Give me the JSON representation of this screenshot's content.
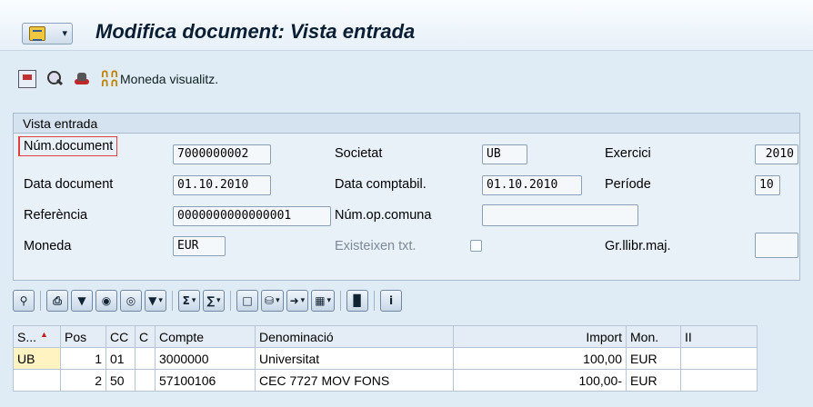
{
  "header": {
    "title": "Modifica document: Vista entrada"
  },
  "toolbar": {
    "currency_label": "Moneda visualitz."
  },
  "section": {
    "title": "Vista entrada"
  },
  "fields": {
    "num_document": {
      "label": "Núm.document",
      "value": "7000000002"
    },
    "societat": {
      "label": "Societat",
      "value": "UB"
    },
    "exercici": {
      "label": "Exercici",
      "value": "2010"
    },
    "data_document": {
      "label": "Data document",
      "value": "01.10.2010"
    },
    "data_comptabil": {
      "label": "Data comptabil.",
      "value": "01.10.2010"
    },
    "periode": {
      "label": "Període",
      "value": "10"
    },
    "referencia": {
      "label": "Referència",
      "value": "0000000000000001"
    },
    "num_op_comuna": {
      "label": "Núm.op.comuna",
      "value": ""
    },
    "moneda": {
      "label": "Moneda",
      "value": "EUR"
    },
    "existeixen_txt": {
      "label": "Existeixen txt."
    },
    "gr_llibr_maj": {
      "label": "Gr.llibr.maj.",
      "value": ""
    }
  },
  "alv": {
    "sigma": "Σ",
    "info": "i"
  },
  "table": {
    "columns": [
      "S...",
      "Pos",
      "CC",
      "C",
      "Compte",
      "Denominació",
      "Import",
      "Mon.",
      "II"
    ],
    "rows": [
      {
        "s": "UB",
        "pos": "1",
        "cc": "01",
        "c": "",
        "compte": "3000000",
        "denominacio": "Universitat",
        "import": "100,00",
        "mon": "EUR",
        "ii": ""
      },
      {
        "s": "",
        "pos": "2",
        "cc": "50",
        "c": "",
        "compte": "57100106",
        "denominacio": "CEC 7727 MOV FONS",
        "import": "100,00-",
        "mon": "EUR",
        "ii": ""
      }
    ]
  },
  "colors": {
    "background": "#dfebf5",
    "title": "#0a1f33",
    "required_marker": "#e04040",
    "selected_cell": "#fff3c2"
  }
}
